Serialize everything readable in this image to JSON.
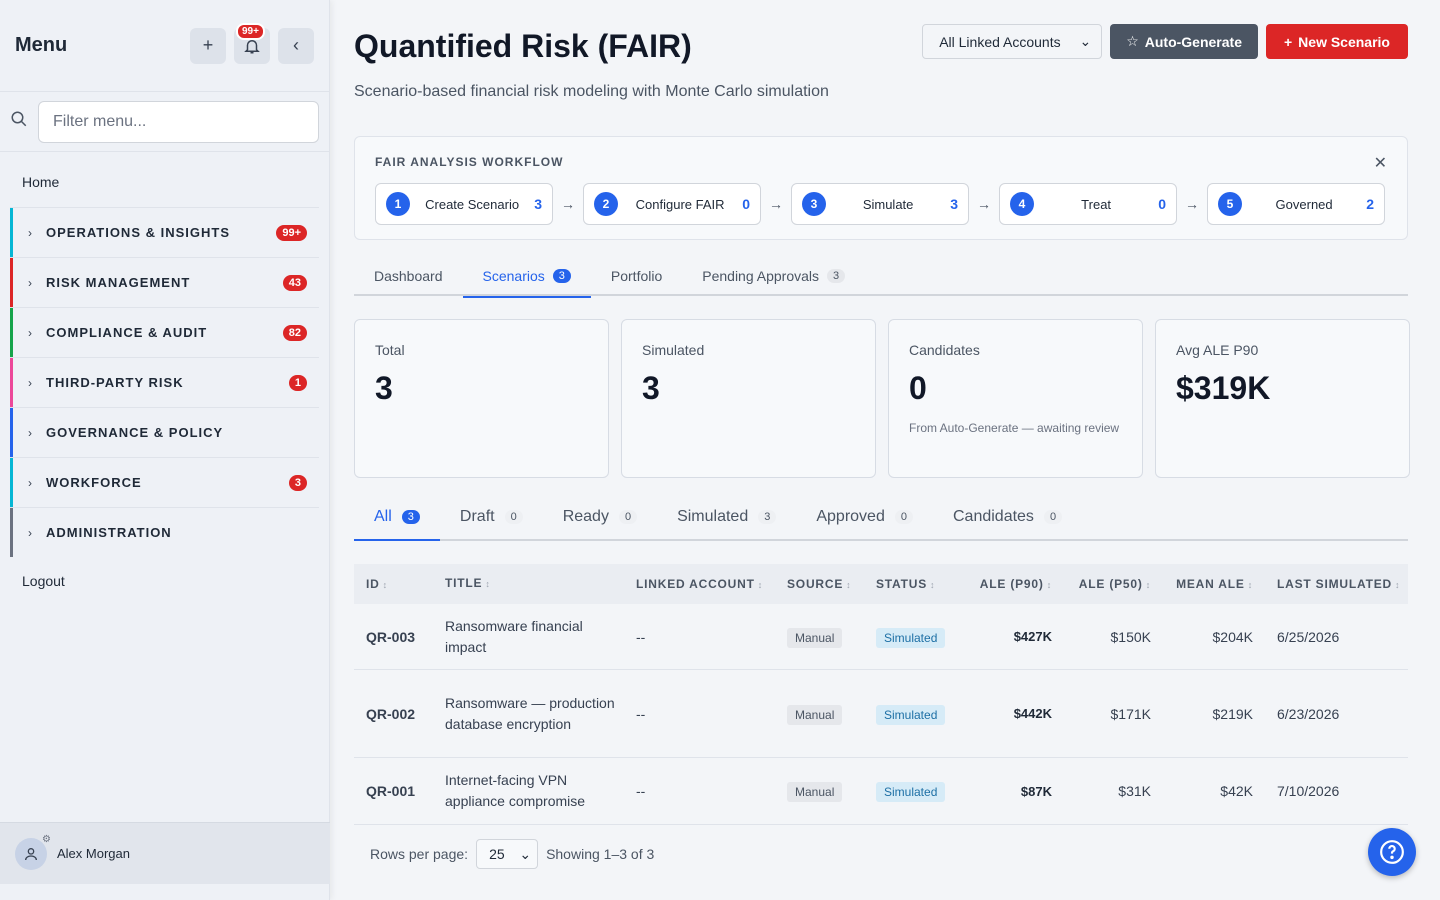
{
  "sidebar": {
    "title": "Menu",
    "notif_badge": "99+",
    "filter_placeholder": "Filter menu...",
    "home": "Home",
    "sections": [
      {
        "label": "OPERATIONS & INSIGHTS",
        "count": "99+",
        "color": "#06b6d4"
      },
      {
        "label": "RISK MANAGEMENT",
        "count": "43",
        "color": "#dc2626"
      },
      {
        "label": "COMPLIANCE & AUDIT",
        "count": "82",
        "color": "#16a34a"
      },
      {
        "label": "THIRD-PARTY RISK",
        "count": "1",
        "color": "#ec4899"
      },
      {
        "label": "GOVERNANCE & POLICY",
        "count": "",
        "color": "#2563eb"
      },
      {
        "label": "WORKFORCE",
        "count": "3",
        "color": "#06b6d4"
      },
      {
        "label": "ADMINISTRATION",
        "count": "",
        "color": "#6b7280"
      }
    ],
    "logout": "Logout",
    "user": "Alex Morgan"
  },
  "header": {
    "title": "Quantified Risk (FAIR)",
    "subtitle": "Scenario-based financial risk modeling with Monte Carlo simulation",
    "account_select": "All Linked Accounts",
    "auto_generate": "Auto-Generate",
    "new_scenario": "New Scenario"
  },
  "workflow": {
    "title": "FAIR ANALYSIS WORKFLOW",
    "steps": [
      {
        "num": "1",
        "label": "Create Scenario",
        "count": "3"
      },
      {
        "num": "2",
        "label": "Configure FAIR",
        "count": "0"
      },
      {
        "num": "3",
        "label": "Simulate",
        "count": "3"
      },
      {
        "num": "4",
        "label": "Treat",
        "count": "0"
      },
      {
        "num": "5",
        "label": "Governed",
        "count": "2"
      }
    ]
  },
  "tabs": [
    {
      "label": "Dashboard",
      "count": ""
    },
    {
      "label": "Scenarios",
      "count": "3"
    },
    {
      "label": "Portfolio",
      "count": ""
    },
    {
      "label": "Pending Approvals",
      "count": "3"
    }
  ],
  "cards": [
    {
      "label": "Total",
      "value": "3",
      "sub": ""
    },
    {
      "label": "Simulated",
      "value": "3",
      "sub": ""
    },
    {
      "label": "Candidates",
      "value": "0",
      "sub": "From Auto-Generate — awaiting review"
    },
    {
      "label": "Avg ALE P90",
      "value": "$319K",
      "sub": ""
    }
  ],
  "subtabs": [
    {
      "label": "All",
      "count": "3"
    },
    {
      "label": "Draft",
      "count": "0"
    },
    {
      "label": "Ready",
      "count": "0"
    },
    {
      "label": "Simulated",
      "count": "3"
    },
    {
      "label": "Approved",
      "count": "0"
    },
    {
      "label": "Candidates",
      "count": "0"
    }
  ],
  "table": {
    "headers": [
      "ID",
      "TITLE",
      "LINKED ACCOUNT",
      "SOURCE",
      "STATUS",
      "ALE (P90)",
      "ALE (P50)",
      "MEAN ALE",
      "LAST SIMULATED"
    ],
    "rows": [
      {
        "id": "QR-003",
        "title": "Ransomware financial impact",
        "account": "--",
        "source": "Manual",
        "status": "Simulated",
        "p90": "$427K",
        "p50": "$150K",
        "mean": "$204K",
        "last": "6/25/2026"
      },
      {
        "id": "QR-002",
        "title": "Ransomware — production database encryption",
        "account": "--",
        "source": "Manual",
        "status": "Simulated",
        "p90": "$442K",
        "p50": "$171K",
        "mean": "$219K",
        "last": "6/23/2026"
      },
      {
        "id": "QR-001",
        "title": "Internet-facing VPN appliance compromise",
        "account": "--",
        "source": "Manual",
        "status": "Simulated",
        "p90": "$87K",
        "p50": "$31K",
        "mean": "$42K",
        "last": "7/10/2026"
      }
    ]
  },
  "pager": {
    "rows_label": "Rows per page:",
    "rows_value": "25",
    "showing": "Showing 1–3 of 3"
  }
}
